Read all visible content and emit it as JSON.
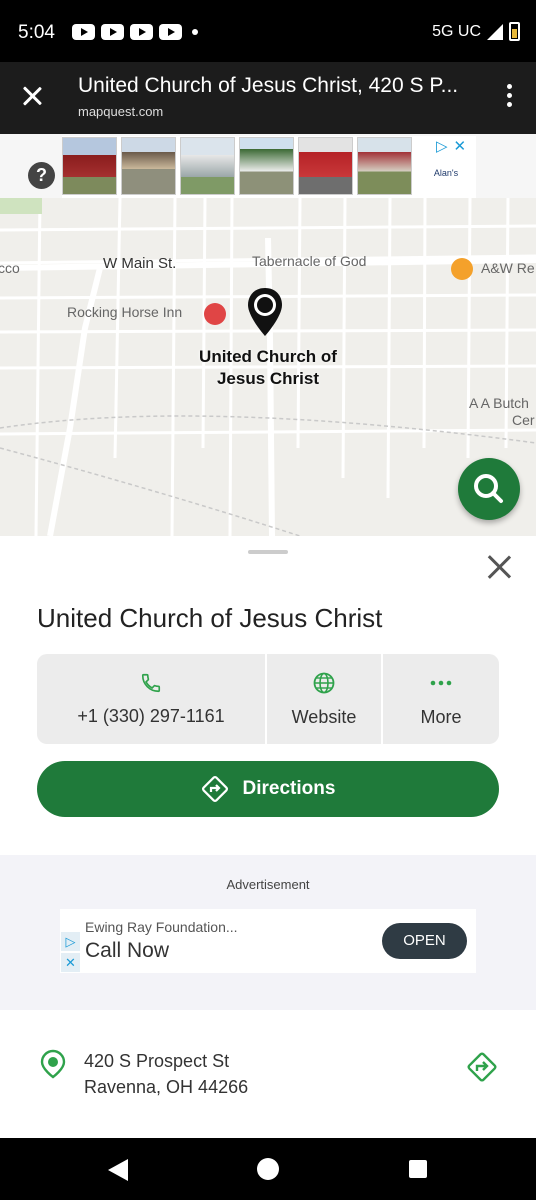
{
  "status_bar": {
    "time": "5:04",
    "network": "5G UC"
  },
  "app_bar": {
    "title": "United Church of Jesus Christ, 420 S P...",
    "subtitle": "mapquest.com"
  },
  "top_ad": {
    "help": "?",
    "brand": "Alan's"
  },
  "map": {
    "labels": {
      "street_main": "W Main St.",
      "tabernacle": "Tabernacle of God",
      "aw": "A&W Re",
      "rocking_horse": "Rocking Horse Inn",
      "acco": "cco",
      "butch": "A A Butch",
      "cer": "Cer"
    },
    "pin_label": "United Church of Jesus Christ"
  },
  "place": {
    "title": "United Church of Jesus Christ",
    "phone": "+1 (330) 297-1161",
    "website": "Website",
    "more": "More",
    "directions": "Directions"
  },
  "ad": {
    "label": "Advertisement",
    "sponsor": "Ewing Ray Foundation...",
    "cta": "Call Now",
    "button": "OPEN"
  },
  "address": {
    "line1": "420 S Prospect St",
    "line2": "Ravenna, OH 44266"
  },
  "colors": {
    "brand_green": "#1f7a3a",
    "icon_green": "#2fa24b"
  }
}
